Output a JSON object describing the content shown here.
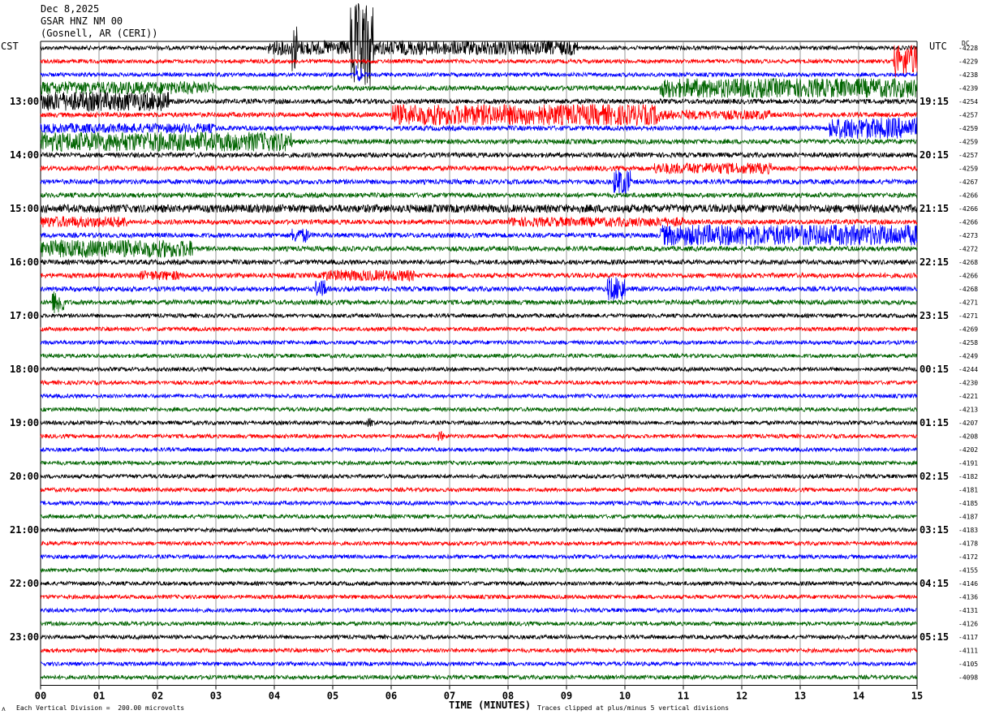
{
  "header": {
    "date": "Dec 8,2025",
    "station": "GSAR HNZ NM 00",
    "location": "(Gosnell, AR (CERI))"
  },
  "left_tz": "CST",
  "right_tz": "UTC",
  "dc_label": "DC",
  "footer": {
    "scale_note": "Each Vertical Division =  200.00 microvolts",
    "clip_note": "Traces clipped at plus/minus 5 vertical divisions",
    "corner_mark": "ᴧ"
  },
  "colors": {
    "black": "#000000",
    "red": "#ff0000",
    "blue": "#0000ff",
    "green": "#006400",
    "grid": "#808080"
  },
  "chart_data": {
    "type": "line",
    "xlabel": "TIME (MINUTES)",
    "xlim": [
      0,
      15
    ],
    "x_ticks": [
      "00",
      "01",
      "02",
      "03",
      "04",
      "05",
      "06",
      "07",
      "08",
      "09",
      "10",
      "11",
      "12",
      "13",
      "14",
      "15"
    ],
    "trace_color_cycle": [
      "black",
      "red",
      "blue",
      "green"
    ],
    "left_time_labels": [
      "13:00",
      "14:00",
      "15:00",
      "16:00",
      "17:00",
      "18:00",
      "19:00",
      "20:00",
      "21:00",
      "22:00",
      "23:00"
    ],
    "right_time_labels": [
      "19:15",
      "20:15",
      "21:15",
      "22:15",
      "23:15",
      "00:15",
      "01:15",
      "02:15",
      "03:15",
      "04:15",
      "05:15"
    ],
    "dc_offsets": [
      "-4228",
      "-4229",
      "-4238",
      "-4239",
      "-4254",
      "-4257",
      "-4259",
      "-4259",
      "-4257",
      "-4259",
      "-4267",
      "-4266",
      "-4266",
      "-4266",
      "-4273",
      "-4272",
      "-4268",
      "-4266",
      "-4268",
      "-4271",
      "-4271",
      "-4269",
      "-4258",
      "-4249",
      "-4244",
      "-4230",
      "-4221",
      "-4213",
      "-4207",
      "-4208",
      "-4202",
      "-4191",
      "-4182",
      "-4181",
      "-4185",
      "-4187",
      "-4183",
      "-4178",
      "-4172",
      "-4155",
      "-4146",
      "-4136",
      "-4131",
      "-4126",
      "-4117",
      "-4111",
      "-4105",
      "-4098"
    ],
    "traces": [
      {
        "amp": 2.5,
        "events": [
          {
            "t0": 3.9,
            "t1": 9.2,
            "amp": 9
          },
          {
            "t0": 4.3,
            "t1": 4.4,
            "amp": 30
          },
          {
            "t0": 5.3,
            "t1": 5.7,
            "amp": 55
          }
        ]
      },
      {
        "amp": 2.5,
        "events": [
          {
            "t0": 14.6,
            "t1": 15.0,
            "amp": 20
          }
        ]
      },
      {
        "amp": 2.5,
        "events": [
          {
            "t0": 5.4,
            "t1": 5.5,
            "amp": 12
          }
        ]
      },
      {
        "amp": 3,
        "events": [
          {
            "t0": 0,
            "t1": 3.0,
            "amp": 8
          },
          {
            "t0": 10.6,
            "t1": 15.0,
            "amp": 12
          }
        ]
      },
      {
        "amp": 3,
        "events": [
          {
            "t0": 0,
            "t1": 2.2,
            "amp": 12
          }
        ]
      },
      {
        "amp": 3,
        "events": [
          {
            "t0": 6.0,
            "t1": 10.6,
            "amp": 13
          },
          {
            "t0": 10.6,
            "t1": 12.5,
            "amp": 6
          }
        ]
      },
      {
        "amp": 3,
        "events": [
          {
            "t0": 0,
            "t1": 3.0,
            "amp": 6
          },
          {
            "t0": 13.5,
            "t1": 15.0,
            "amp": 13
          }
        ]
      },
      {
        "amp": 3,
        "events": [
          {
            "t0": 0,
            "t1": 4.3,
            "amp": 12
          }
        ]
      },
      {
        "amp": 3,
        "events": []
      },
      {
        "amp": 3,
        "events": [
          {
            "t0": 10.5,
            "t1": 12.5,
            "amp": 7
          }
        ]
      },
      {
        "amp": 3,
        "events": [
          {
            "t0": 9.8,
            "t1": 10.1,
            "amp": 16
          }
        ]
      },
      {
        "amp": 3,
        "events": []
      },
      {
        "amp": 3.5,
        "events": [
          {
            "t0": 0,
            "t1": 15.0,
            "amp": 5
          }
        ]
      },
      {
        "amp": 3,
        "events": [
          {
            "t0": 0,
            "t1": 1.5,
            "amp": 7
          },
          {
            "t0": 8.0,
            "t1": 11.0,
            "amp": 6
          }
        ]
      },
      {
        "amp": 3,
        "events": [
          {
            "t0": 4.3,
            "t1": 4.6,
            "amp": 9
          },
          {
            "t0": 10.6,
            "t1": 15.0,
            "amp": 13
          }
        ]
      },
      {
        "amp": 3,
        "events": [
          {
            "t0": 0,
            "t1": 2.6,
            "amp": 11
          }
        ]
      },
      {
        "amp": 3,
        "events": []
      },
      {
        "amp": 3,
        "events": [
          {
            "t0": 1.7,
            "t1": 2.4,
            "amp": 6
          },
          {
            "t0": 4.8,
            "t1": 6.4,
            "amp": 7
          }
        ]
      },
      {
        "amp": 3,
        "events": [
          {
            "t0": 4.7,
            "t1": 4.9,
            "amp": 11
          },
          {
            "t0": 9.7,
            "t1": 10.0,
            "amp": 15
          }
        ]
      },
      {
        "amp": 3,
        "events": [
          {
            "t0": 0.2,
            "t1": 0.4,
            "amp": 15
          }
        ]
      },
      {
        "amp": 2.5,
        "events": []
      },
      {
        "amp": 2.5,
        "events": []
      },
      {
        "amp": 2.5,
        "events": []
      },
      {
        "amp": 2.5,
        "events": []
      },
      {
        "amp": 2.5,
        "events": []
      },
      {
        "amp": 2.5,
        "events": []
      },
      {
        "amp": 2.5,
        "events": []
      },
      {
        "amp": 2.5,
        "events": []
      },
      {
        "amp": 2.5,
        "events": [
          {
            "t0": 5.6,
            "t1": 5.7,
            "amp": 6
          }
        ]
      },
      {
        "amp": 2.5,
        "events": [
          {
            "t0": 6.8,
            "t1": 6.9,
            "amp": 6
          }
        ]
      },
      {
        "amp": 2.5,
        "events": []
      },
      {
        "amp": 2.5,
        "events": []
      },
      {
        "amp": 2.5,
        "events": []
      },
      {
        "amp": 2.5,
        "events": []
      },
      {
        "amp": 2.5,
        "events": []
      },
      {
        "amp": 2.5,
        "events": []
      },
      {
        "amp": 2.5,
        "events": []
      },
      {
        "amp": 2.5,
        "events": []
      },
      {
        "amp": 2.5,
        "events": []
      },
      {
        "amp": 2.5,
        "events": []
      },
      {
        "amp": 2.5,
        "events": []
      },
      {
        "amp": 2.5,
        "events": []
      },
      {
        "amp": 2.5,
        "events": []
      },
      {
        "amp": 2.5,
        "events": []
      },
      {
        "amp": 2.5,
        "events": []
      },
      {
        "amp": 2.5,
        "events": []
      },
      {
        "amp": 2.5,
        "events": []
      },
      {
        "amp": 2.5,
        "events": []
      }
    ]
  }
}
